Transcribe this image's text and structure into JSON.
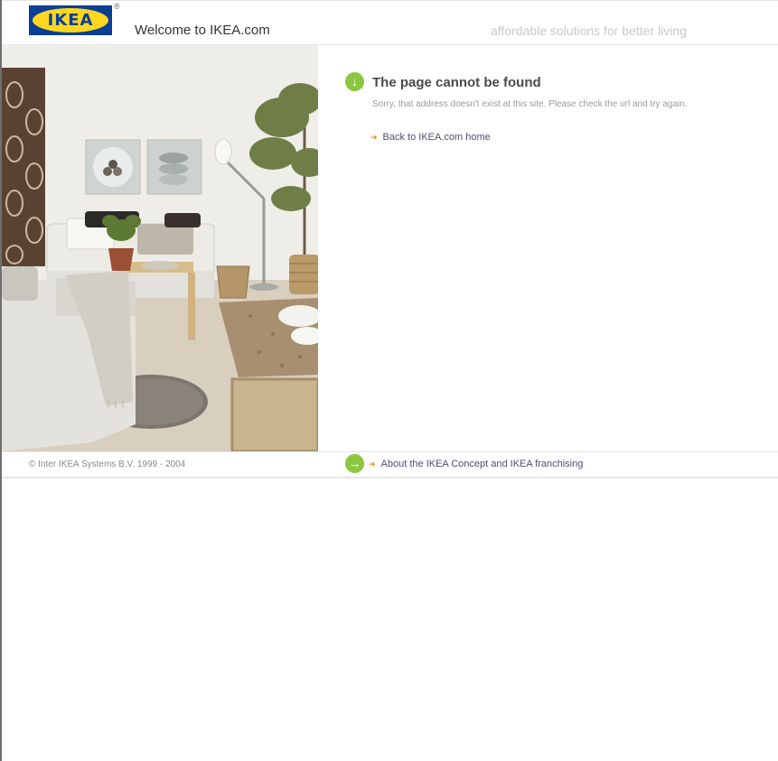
{
  "header": {
    "logo_text": "IKEA",
    "logo_registered": "®",
    "welcome": "Welcome to IKEA.com",
    "tagline": "affordable solutions for better living"
  },
  "message": {
    "title": "The page cannot be found",
    "body": "Sorry, that address doesn't exist at this site. Please check the url and try again.",
    "home_link": "Back to IKEA.com home"
  },
  "footer": {
    "copyright": "© Inter IKEA Systems B.V. 1999 - 2004",
    "concept_link": "About the IKEA Concept and IKEA franchising"
  },
  "icons": {
    "message_icon": "down-arrow-circle-icon",
    "footer_icon": "right-arrow-circle-icon",
    "link_arrow": "small-arrow-icon"
  },
  "colors": {
    "brand_blue": "#0a3f96",
    "brand_yellow": "#ffd71e",
    "accent_green": "#8dc63f",
    "link": "#4d4d7a"
  }
}
